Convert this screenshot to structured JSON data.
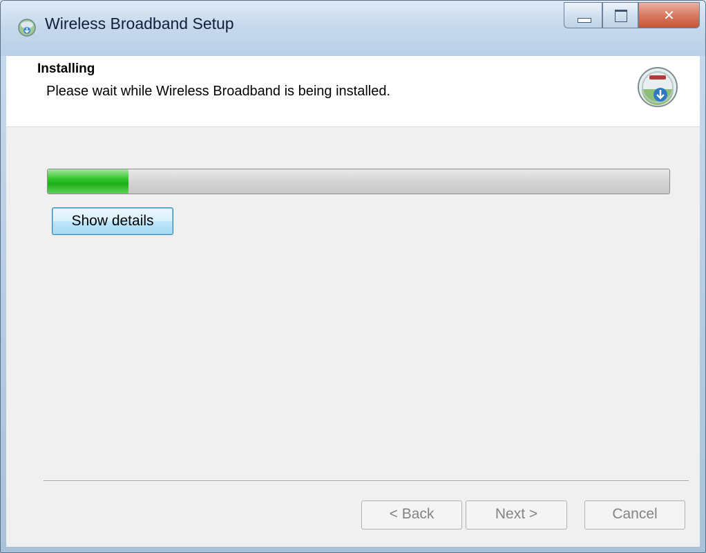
{
  "window": {
    "title": "Wireless Broadband Setup",
    "icon": "globe-download-icon"
  },
  "title_buttons": {
    "minimize_icon": "minimize-icon",
    "maximize_icon": "maximize-icon",
    "close_icon": "close-icon",
    "close_glyph": "✕"
  },
  "header": {
    "title": "Installing",
    "subtitle": "Please wait while Wireless Broadband is being installed.",
    "icon": "installer-badge-icon"
  },
  "progress": {
    "fraction": 0.13,
    "color": "#2fc229"
  },
  "buttons": {
    "show_details": "Show details",
    "back": "< Back",
    "next": "Next >",
    "cancel": "Cancel"
  },
  "colors": {
    "client_bg": "#f0f0f0",
    "header_bg": "#ffffff",
    "focus_border": "#3c7fb1"
  }
}
